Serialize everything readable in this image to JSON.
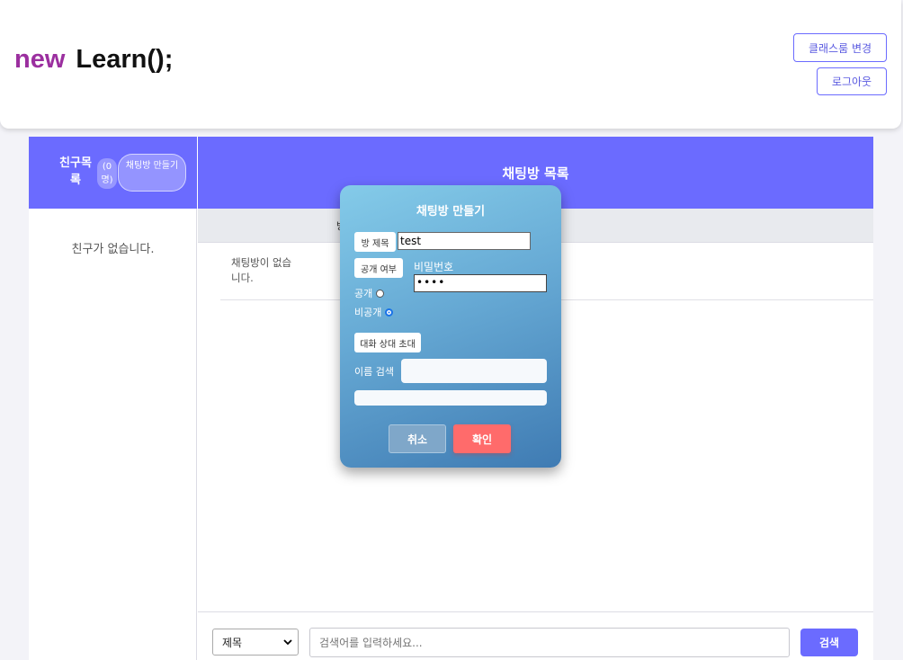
{
  "header": {
    "logo_keyword": "new",
    "logo_text": "Learn();",
    "classroom_button": "클래스룸 변경",
    "logout_button": "로그아웃"
  },
  "sidebar": {
    "title": "친구목록",
    "count": "(0명)",
    "create_room_button": "채팅방 만들기",
    "empty_text": "친구가 없습니다."
  },
  "content": {
    "title": "채팅방 목록",
    "column_header": "방",
    "empty_text": "채팅방이 없습니다."
  },
  "search": {
    "select_value": "제목",
    "placeholder": "검색어를 입력하세요...",
    "button": "검색"
  },
  "modal": {
    "title": "채팅방 만들기",
    "room_title_label": "방 제목",
    "room_title_value": "test",
    "public_label": "공개 여부",
    "password_label": "비밀번호",
    "password_value": "••••",
    "option_public": "공개",
    "option_private": "비공개",
    "selected_option": "비공개",
    "invite_label": "대화 상대 초대",
    "name_search_label": "이름 검색",
    "cancel_button": "취소",
    "confirm_button": "확인"
  },
  "colors": {
    "accent": "#6b6bff",
    "logo_keyword": "#9b2f9f",
    "confirm": "#ff6b6b"
  }
}
